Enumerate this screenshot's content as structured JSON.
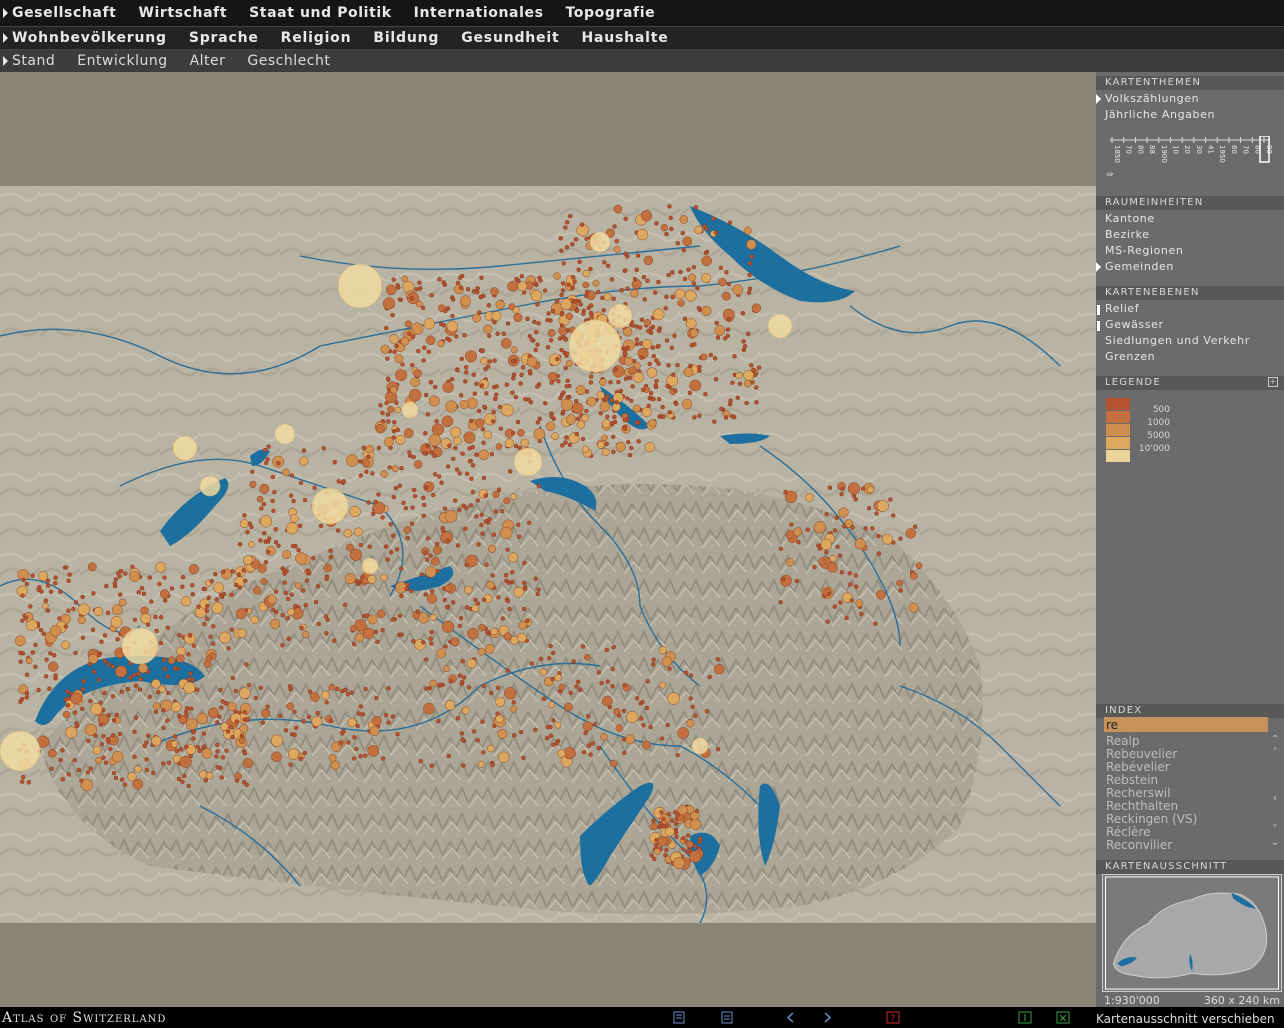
{
  "nav": {
    "level1": [
      "Gesellschaft",
      "Wirtschaft",
      "Staat und Politik",
      "Internationales",
      "Topografie"
    ],
    "level2": [
      "Wohnbevölkerung",
      "Sprache",
      "Religion",
      "Bildung",
      "Gesundheit",
      "Haushalte"
    ],
    "level3": [
      "Stand",
      "Entwicklung",
      "Alter",
      "Geschlecht"
    ]
  },
  "panel": {
    "kartenthemen": {
      "title": "KARTENTHEMEN",
      "items": [
        "Volkszählungen",
        "Jährliche Angaben"
      ],
      "years": [
        "1850",
        "70",
        "80",
        "88",
        "1900",
        "10",
        "20",
        "30",
        "41",
        "1950",
        "60",
        "70",
        "80",
        "90"
      ]
    },
    "raumeinheiten": {
      "title": "RAUMEINHEITEN",
      "items": [
        "Kantone",
        "Bezirke",
        "MS-Regionen",
        "Gemeinden"
      ]
    },
    "kartenebenen": {
      "title": "KARTENEBENEN",
      "items": [
        "Relief",
        "Gewässer",
        "Siedlungen und Verkehr",
        "Grenzen"
      ]
    },
    "legende": {
      "title": "LEGENDE",
      "labels": [
        "500",
        "1000",
        "5000",
        "10'000"
      ],
      "colors": [
        "#b5522f",
        "#c2703f",
        "#cf8f4f",
        "#dca860",
        "#ecd39a"
      ]
    },
    "index": {
      "title": "INDEX",
      "query": "re",
      "results": [
        "Realp",
        "Rebeuvelier",
        "Rebévelier",
        "Rebstein",
        "Recherswil",
        "Rechthalten",
        "Reckingen (VS)",
        "Réclère",
        "Reconvilier"
      ]
    },
    "kartenausschnitt": {
      "title": "KARTENAUSSCHNITT",
      "scale": "1:930'000",
      "dimensions": "360 x 240 km"
    }
  },
  "footer": {
    "brand": "Atlas of Switzerland",
    "status": "Kartenausschnitt verschieben"
  },
  "colors": {
    "water": "#1c6f9e",
    "terrain": "#b9b3a3",
    "small_settlement": "#b5522f",
    "large_settlement": "#f1dba2"
  }
}
